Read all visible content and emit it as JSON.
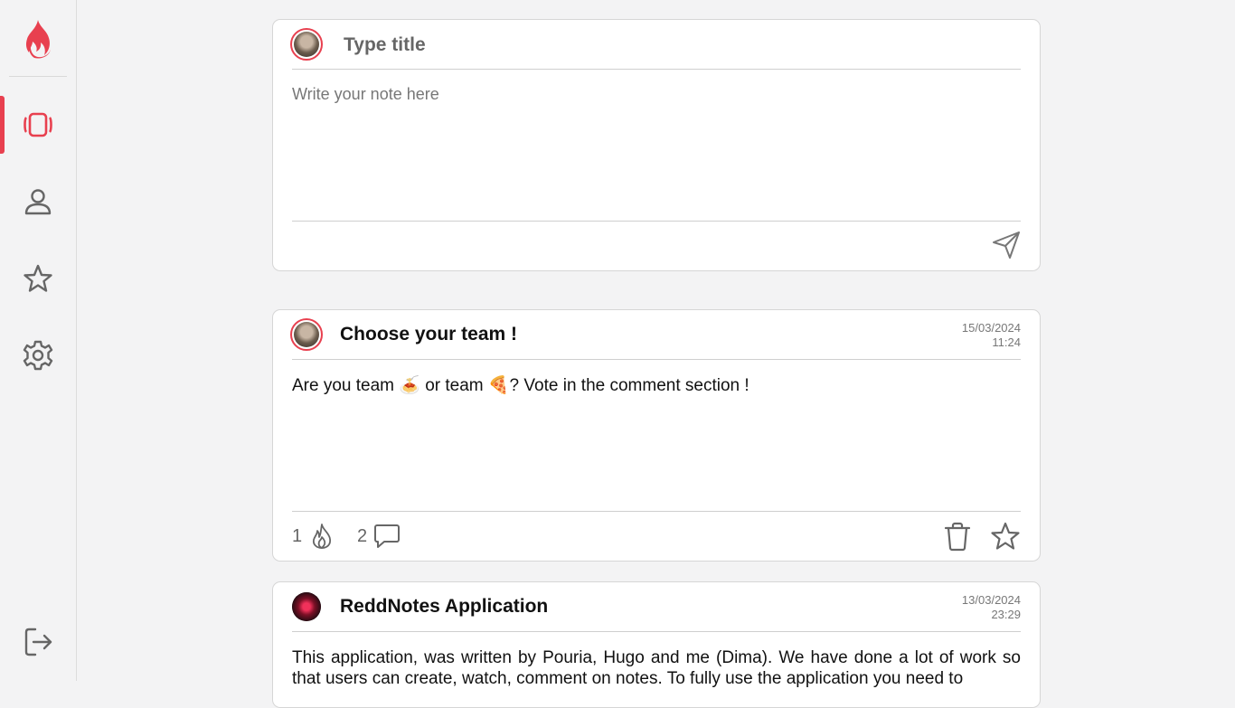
{
  "sidebar": {
    "logo": "flame-logo",
    "items": [
      {
        "name": "notes",
        "icon": "cards-icon",
        "active": true
      },
      {
        "name": "profile",
        "icon": "user-icon",
        "active": false
      },
      {
        "name": "favorites",
        "icon": "star-icon",
        "active": false
      },
      {
        "name": "settings",
        "icon": "gear-icon",
        "active": false
      }
    ],
    "logout_icon": "logout-icon"
  },
  "composer": {
    "title_placeholder": "Type title",
    "body_placeholder": "Write your note here",
    "send_icon": "send-icon"
  },
  "posts": [
    {
      "title": "Choose your team !",
      "date": "15/03/2024",
      "time": "11:24",
      "body": "Are you team 🍝 or team 🍕? Vote in the comment section !",
      "likes": "1",
      "comments": "2"
    },
    {
      "title": "ReddNotes Application",
      "date": "13/03/2024",
      "time": "23:29",
      "body": "This application, was written by Pouria, Hugo and me (Dima). We have done a lot of work so that users can create, watch, comment on notes. To fully use the application you need to"
    }
  ],
  "colors": {
    "accent": "#e8404f",
    "background": "#f3f3f4",
    "card": "#ffffff"
  }
}
